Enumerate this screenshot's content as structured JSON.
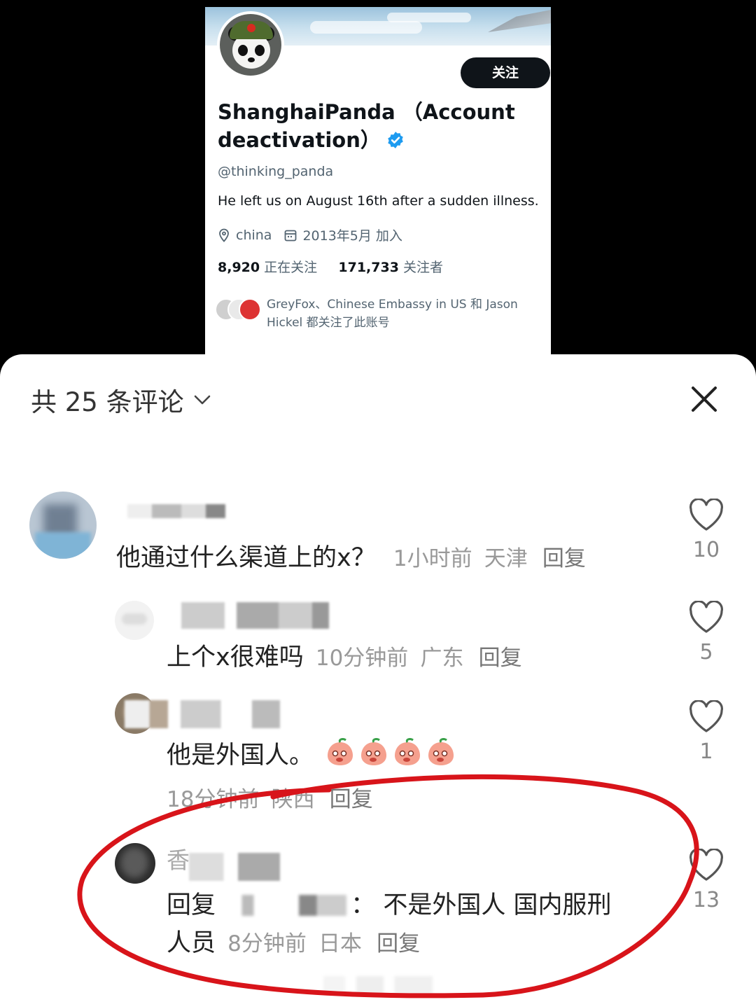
{
  "profile": {
    "follow_label": "关注",
    "name_line1": "ShanghaiPanda （Account",
    "name_line2": "deactivation）",
    "handle": "@thinking_panda",
    "bio": "He left us on August 16th after a sudden illness.",
    "location": "china",
    "joined": "2013年5月 加入",
    "following_count": "8,920",
    "following_label": "正在关注",
    "followers_count": "171,733",
    "followers_label": "关注者",
    "followed_by_line1": "GreyFox、Chinese Embassy in US 和 Jason",
    "followed_by_line2": "Hickel 都关注了此账号"
  },
  "sheet": {
    "title": "共 25 条评论"
  },
  "comments": [
    {
      "text": "他通过什么渠道上的x？",
      "time": "1小时前",
      "region": "天津",
      "reply": "回复",
      "likes": "10"
    },
    {
      "text": "上个x很难吗",
      "time": "10分钟前",
      "region": "广东",
      "reply": "回复",
      "likes": "5"
    },
    {
      "text": "他是外国人。",
      "time": "18分钟前",
      "region": "陕西",
      "reply": "回复",
      "likes": "1"
    },
    {
      "username_char": "香",
      "reply_prefix": "回复",
      "text": "不是外国人 国内服刑",
      "text_line2": "人员",
      "time": "8分钟前",
      "region": "日本",
      "reply": "回复",
      "likes": "13"
    }
  ],
  "colors": {
    "annotation": "#d8141a",
    "verified": "#1d9bf0"
  }
}
